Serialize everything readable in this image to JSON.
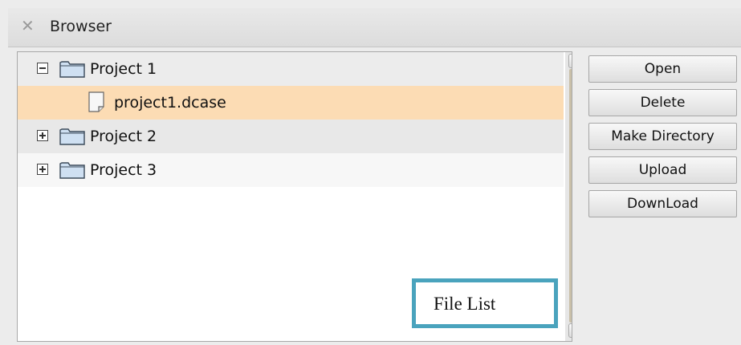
{
  "window": {
    "title": "Browser",
    "close_glyph": "✕"
  },
  "tree": {
    "items": [
      {
        "label": "Project 1",
        "type": "folder",
        "state": "expanded",
        "selected": false
      },
      {
        "label": "project1.dcase",
        "type": "file",
        "selected": true
      },
      {
        "label": "Project 2",
        "type": "folder",
        "state": "collapsed",
        "selected": false
      },
      {
        "label": "Project 3",
        "type": "folder",
        "state": "collapsed",
        "selected": false
      }
    ]
  },
  "buttons": {
    "open": "Open",
    "delete": "Delete",
    "make_directory": "Make Directory",
    "upload": "Upload",
    "download": "DownLoad"
  },
  "annotation": {
    "label": "File List"
  },
  "colors": {
    "selection": "#fcdcb4",
    "annotation_border": "#4aa3bd",
    "scroll_thumb": "#c9bfa8",
    "folder_fill": "#cfe0f2",
    "folder_stroke": "#3b4a5a"
  }
}
